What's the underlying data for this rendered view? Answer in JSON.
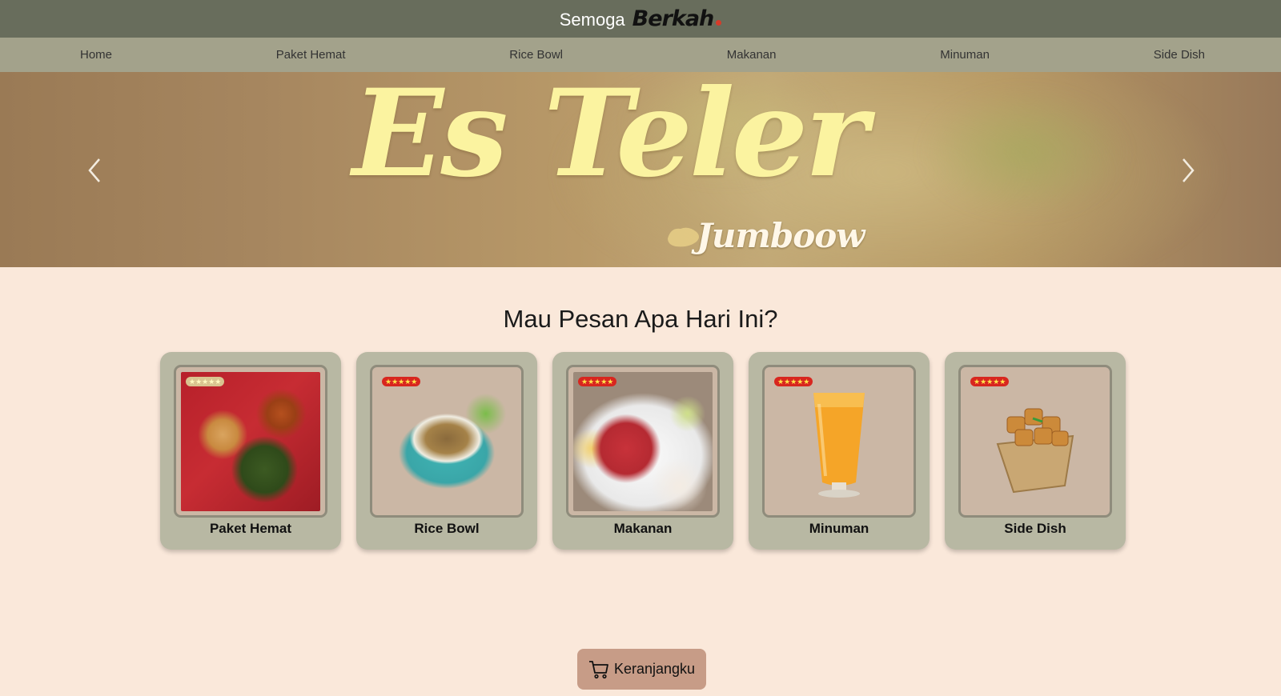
{
  "header": {
    "brand_light": "Semoga",
    "brand_bold": "Berkah"
  },
  "nav": {
    "items": [
      "Home",
      "Paket Hemat",
      "Rice Bowl",
      "Makanan",
      "Minuman",
      "Side Dish"
    ]
  },
  "hero": {
    "title": "Es Teler",
    "subtitle": "Jumboow"
  },
  "main": {
    "heading": "Mau Pesan Apa Hari Ini?",
    "categories": [
      {
        "label": "Paket Hemat",
        "rating_icon": "five-star-badge"
      },
      {
        "label": "Rice Bowl",
        "rating_icon": "five-star-badge"
      },
      {
        "label": "Makanan",
        "rating_icon": "five-star-badge"
      },
      {
        "label": "Minuman",
        "rating_icon": "five-star-badge"
      },
      {
        "label": "Side Dish",
        "rating_icon": "five-star-badge"
      }
    ]
  },
  "cart": {
    "label": "Keranjangku",
    "icon": "shopping-cart-icon"
  },
  "colors": {
    "header_bg": "#686d5c",
    "nav_bg": "#a3a28b",
    "page_bg": "#fae8da",
    "card_bg": "#b8b8a3",
    "cart_bg": "#c79c87",
    "hero_text": "#fbf3a0"
  }
}
